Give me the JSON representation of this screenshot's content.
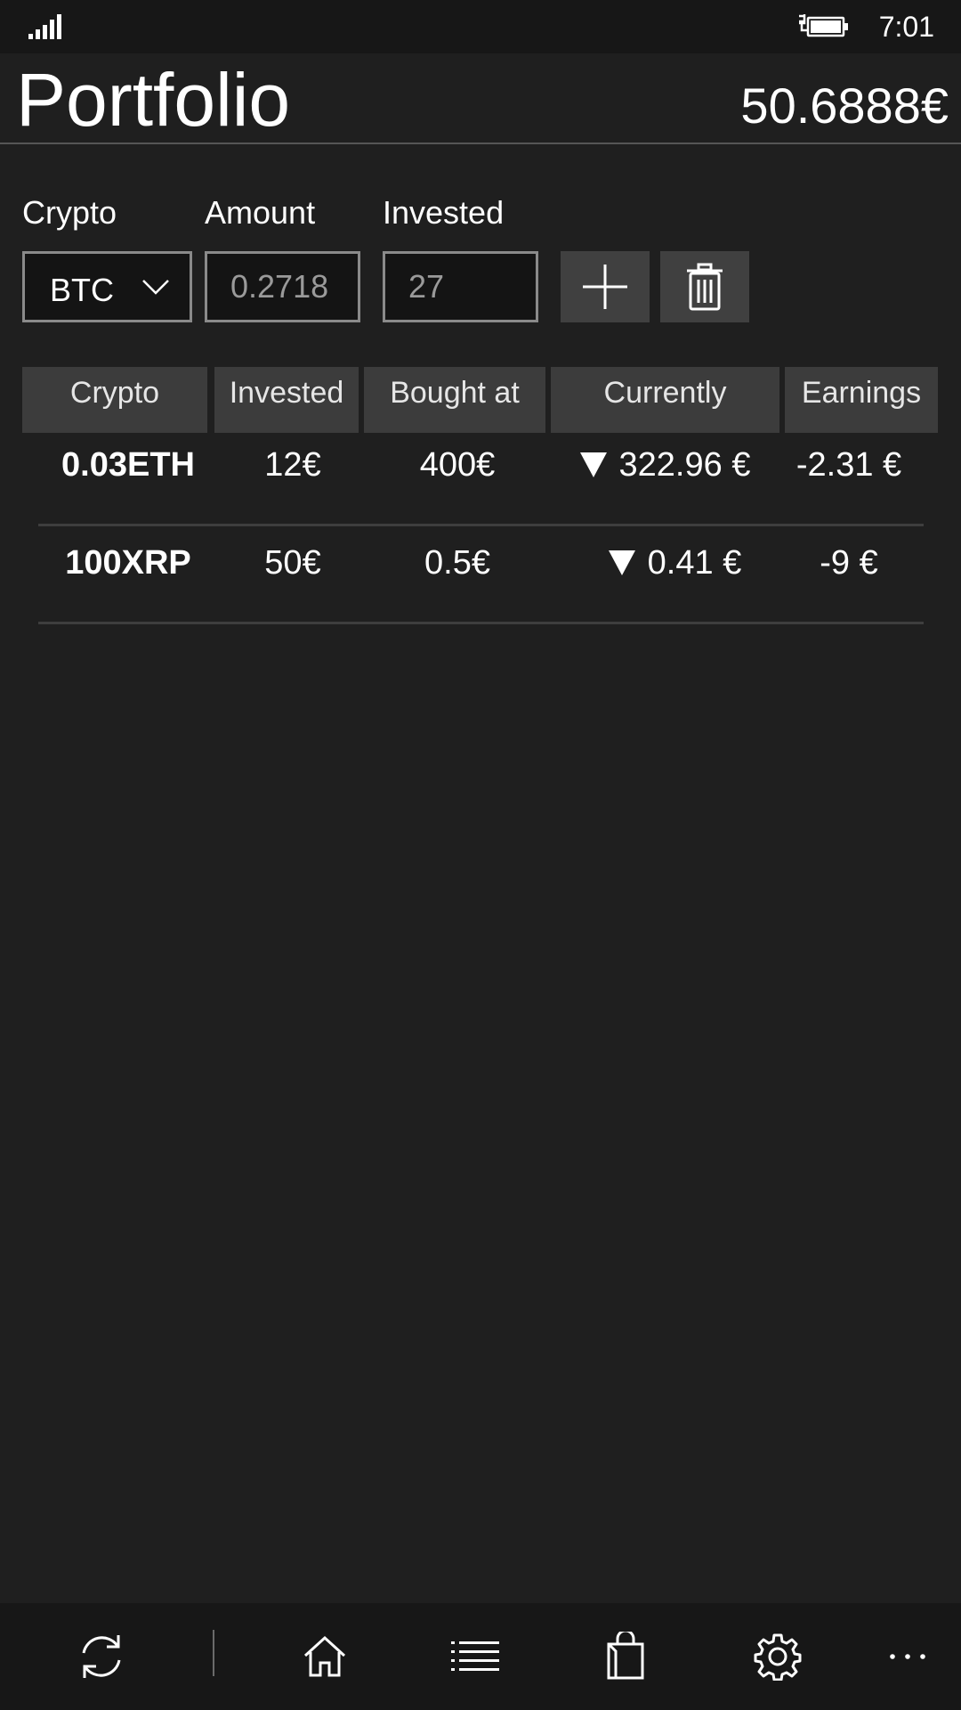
{
  "status_bar": {
    "time": "7:01",
    "signal_icon": "signal-strength-icon",
    "battery_icon": "battery-charging-icon"
  },
  "header": {
    "title": "Portfolio",
    "total": "50.6888€"
  },
  "form": {
    "crypto_label": "Crypto",
    "amount_label": "Amount",
    "invested_label": "Invested",
    "crypto_selected": "BTC",
    "amount_placeholder": "0.2718",
    "invested_placeholder": "27",
    "add_icon": "plus-icon",
    "delete_icon": "trash-icon"
  },
  "table": {
    "headers": [
      "Crypto",
      "Invested",
      "Bought at",
      "Currently",
      "Earnings"
    ],
    "rows": [
      {
        "crypto": "0.03ETH",
        "invested": "12€",
        "bought_at": "400€",
        "currently": "322.96 €",
        "earnings": "-2.31 €",
        "trend": "down"
      },
      {
        "crypto": "100XRP",
        "invested": "50€",
        "bought_at": "0.5€",
        "currently": "0.41 €",
        "earnings": "-9 €",
        "trend": "down"
      }
    ]
  },
  "app_bar": {
    "items": [
      "refresh-icon",
      "home-icon",
      "list-icon",
      "shopping-bag-icon",
      "settings-gear-icon",
      "more-icon"
    ]
  },
  "colors": {
    "background": "#1f1f1f",
    "bar_background": "#171717",
    "header_cell": "#3c3c3c",
    "button": "#404040",
    "input_border": "#8a8a8a"
  }
}
